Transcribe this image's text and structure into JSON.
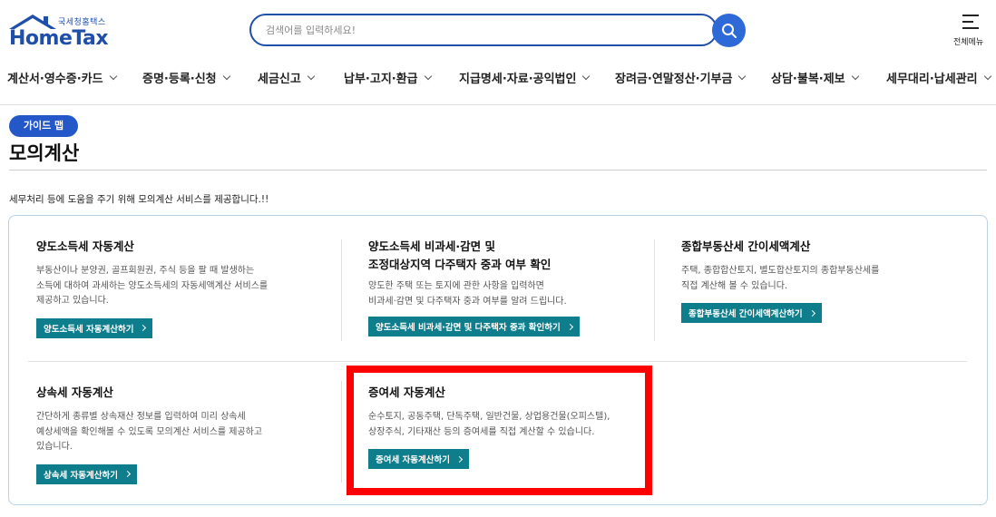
{
  "header": {
    "logo_sub": "국세청홈택스",
    "logo_main": "HomeTax",
    "search_placeholder": "검색어를 입력하세요!",
    "all_menu_label": "전체메뉴"
  },
  "nav": {
    "items": [
      {
        "label": "계산서·영수증·카드"
      },
      {
        "label": "증명·등록·신청"
      },
      {
        "label": "세금신고"
      },
      {
        "label": "납부·고지·환급"
      },
      {
        "label": "지급명세·자료·공익법인"
      },
      {
        "label": "장려금·연말정산·기부금"
      },
      {
        "label": "상담·불복·제보"
      },
      {
        "label": "세무대리·납세관리"
      }
    ]
  },
  "page": {
    "guide_badge": "가이드 맵",
    "title": "모의계산",
    "intro": "세무처리 등에 도움을 주기 위해 모의계산 서비스를 제공합니다.!!"
  },
  "cards": [
    {
      "title_line1": "양도소득세 자동계산",
      "desc_lines": [
        "부동산이나 분양권, 골프회원권, 주식 등을 팔 때 발생하는",
        "소득에 대하여 과세하는 양도소득세의 자동세액계산 서비스를",
        "제공하고 있습니다."
      ],
      "button": "양도소득세 자동계산하기"
    },
    {
      "title_line1": "양도소득세 비과세·감면 및",
      "title_line2": "조정대상지역 다주택자 중과 여부 확인",
      "desc_lines": [
        "양도한 주택 또는 토지에 관한 사항을 입력하면",
        "비과세·감면 및 다주택자 중과 여부를 알려 드립니다."
      ],
      "button": "양도소득세 비과세·감면 및 다주택자 중과 확인하기"
    },
    {
      "title_line1": "종합부동산세 간이세액계산",
      "desc_lines": [
        "주택, 종합합산토지, 별도합산토지의 종합부동산세를",
        "직접 계산해 볼 수 있습니다."
      ],
      "button": "종합부동산세 간이세액계산하기"
    },
    {
      "title_line1": "상속세 자동계산",
      "desc_lines": [
        "간단하게 종류별 상속재산 정보를 입력하여 미리 상속세",
        "예상세액을 확인해볼 수 있도록 모의계산 서비스를 제공하고",
        "있습니다."
      ],
      "button": "상속세 자동계산하기"
    },
    {
      "title_line1": "증여세 자동계산",
      "desc_lines": [
        "순수토지, 공동주택, 단독주택, 일반건물, 상업용건물(오피스텔),",
        "상장주식, 기타재산 등의 증여세를 직접 계산할 수 있습니다."
      ],
      "button": "증여세 자동계산하기"
    }
  ],
  "colors": {
    "brand_blue": "#1f4fa8",
    "button_teal": "#0f7e8c",
    "highlight_red": "#ff0000"
  }
}
